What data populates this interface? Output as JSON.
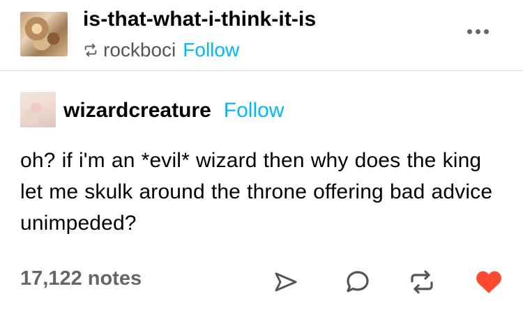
{
  "header": {
    "blog_name": "is-that-what-i-think-it-is",
    "reblogged_from": "rockboci",
    "follow_label": "Follow"
  },
  "post": {
    "author": "wizardcreature",
    "follow_label": "Follow",
    "text": "oh? if i'm an *evil* wizard then why does the king let me skulk around the throne offering bad advice unimpeded?"
  },
  "footer": {
    "notes_count": "17,122 notes",
    "actions": [
      "share-icon",
      "reply-icon",
      "reblog-icon",
      "like-icon"
    ],
    "like_color": "#ff4930"
  },
  "colors": {
    "accent": "#00b8ff",
    "muted_text": "#666666"
  }
}
